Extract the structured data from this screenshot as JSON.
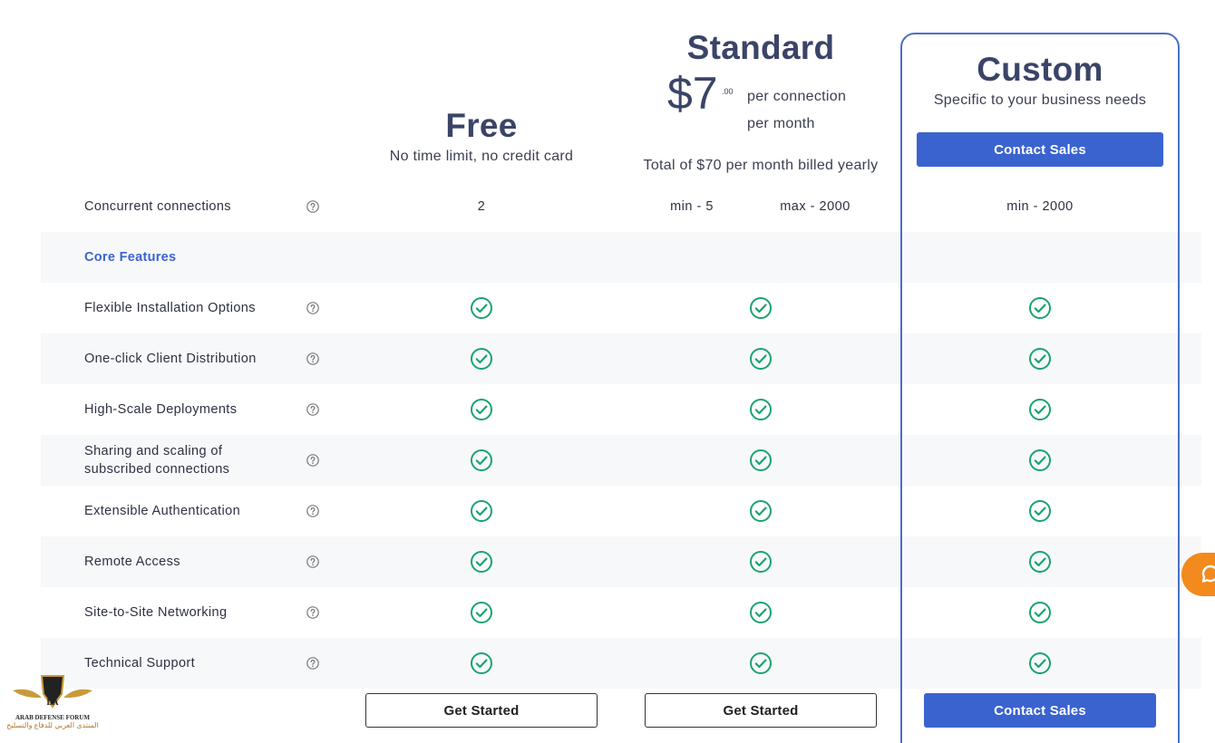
{
  "plans": {
    "free": {
      "title": "Free",
      "subtitle": "No time limit, no credit card",
      "concurrent": "2",
      "cta": "Get Started"
    },
    "standard": {
      "title": "Standard",
      "price": "$7",
      "cents": ".00",
      "unit_line1": "per connection",
      "unit_line2": "per month",
      "billing_note": "Total of $70 per month billed yearly",
      "concurrent_min": "min - 5",
      "concurrent_max": "max - 2000",
      "cta": "Get Started"
    },
    "custom": {
      "title": "Custom",
      "subtitle": "Specific to your business needs",
      "top_cta": "Contact Sales",
      "concurrent": "min - 2000",
      "cta": "Contact Sales"
    }
  },
  "concurrent_row": {
    "label": "Concurrent connections"
  },
  "section": {
    "core_features": "Core Features"
  },
  "features": [
    {
      "label": "Flexible Installation Options",
      "free": true,
      "standard": true,
      "custom": true
    },
    {
      "label": "One-click Client Distribution",
      "free": true,
      "standard": true,
      "custom": true
    },
    {
      "label": "High-Scale Deployments",
      "free": true,
      "standard": true,
      "custom": true
    },
    {
      "label": "Sharing and scaling of subscribed connections",
      "free": true,
      "standard": true,
      "custom": true
    },
    {
      "label": "Extensible Authentication",
      "free": true,
      "standard": true,
      "custom": true
    },
    {
      "label": "Remote Access",
      "free": true,
      "standard": true,
      "custom": true
    },
    {
      "label": "Site-to-Site Networking",
      "free": true,
      "standard": true,
      "custom": true
    },
    {
      "label": "Technical Support",
      "free": true,
      "standard": true,
      "custom": true
    }
  ],
  "watermark": {
    "logo_text": "DA",
    "line1": "ARAB DEFENSE FORUM",
    "line2": "المنتدى العربي للدفاع والتسليح"
  },
  "colors": {
    "accent": "#3a63cf",
    "check": "#1aa36f",
    "chat": "#f28a1e",
    "title": "#3b4468"
  },
  "icons": {
    "help": "help-circle-icon",
    "check": "check-circle-icon",
    "chat": "chat-bubble-icon"
  }
}
